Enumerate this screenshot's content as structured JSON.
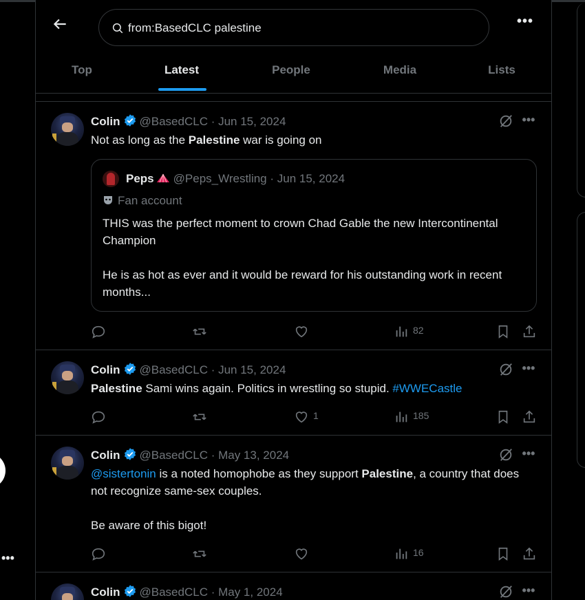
{
  "search": {
    "value": "from:BasedCLC palestine",
    "placeholder": "Search"
  },
  "tabs": [
    {
      "label": "Top",
      "active": false
    },
    {
      "label": "Latest",
      "active": true
    },
    {
      "label": "People",
      "active": false
    },
    {
      "label": "Media",
      "active": false
    },
    {
      "label": "Lists",
      "active": false
    }
  ],
  "colors": {
    "accent": "#1d9bf0",
    "verified": "#1d9bf0",
    "muted": "#71767b",
    "border": "#2f3336"
  },
  "icons": {
    "back": "arrow-left-icon",
    "search": "search-icon",
    "more": "more-icon",
    "grok": "grok-icon",
    "reply": "reply-icon",
    "retweet": "retweet-icon",
    "like": "heart-icon",
    "views": "views-icon",
    "bookmark": "bookmark-icon",
    "share": "share-icon"
  },
  "tweets": [
    {
      "name": "Colin",
      "handle": "@BasedCLC",
      "date": "· Jun 15, 2024",
      "text_parts": {
        "a": "Not as long as the ",
        "b": "Palestine",
        "c": " war is going on"
      },
      "quote": {
        "name": "Peps",
        "handle": "@Peps_Wrestling",
        "date": "· Jun 15, 2024",
        "label": "Fan account",
        "text1": "THIS was the perfect moment to crown Chad Gable the new Intercontinental Champion",
        "text2": "He is as hot as ever and it would be reward for his outstanding work in recent months..."
      },
      "stats": {
        "replies": "",
        "retweets": "",
        "likes": "",
        "views": "82"
      }
    },
    {
      "name": "Colin",
      "handle": "@BasedCLC",
      "date": "· Jun 15, 2024",
      "text_parts": {
        "a": "Palestine",
        "b": " Sami wins again. Politics in wrestling so stupid. ",
        "c": "#WWECastle"
      },
      "stats": {
        "replies": "",
        "retweets": "",
        "likes": "1",
        "views": "185"
      }
    },
    {
      "name": "Colin",
      "handle": "@BasedCLC",
      "date": "· May 13, 2024",
      "text_parts": {
        "a": "@sistertonin",
        "b": " is a noted homophobe as they support ",
        "c": "Palestine",
        "d": ", a country that does not recognize same-sex couples."
      },
      "text2": "Be aware of this bigot!",
      "stats": {
        "replies": "",
        "retweets": "",
        "likes": "",
        "views": "16"
      }
    },
    {
      "name": "Colin",
      "handle": "@BasedCLC",
      "date": "· May 1, 2024"
    }
  ]
}
